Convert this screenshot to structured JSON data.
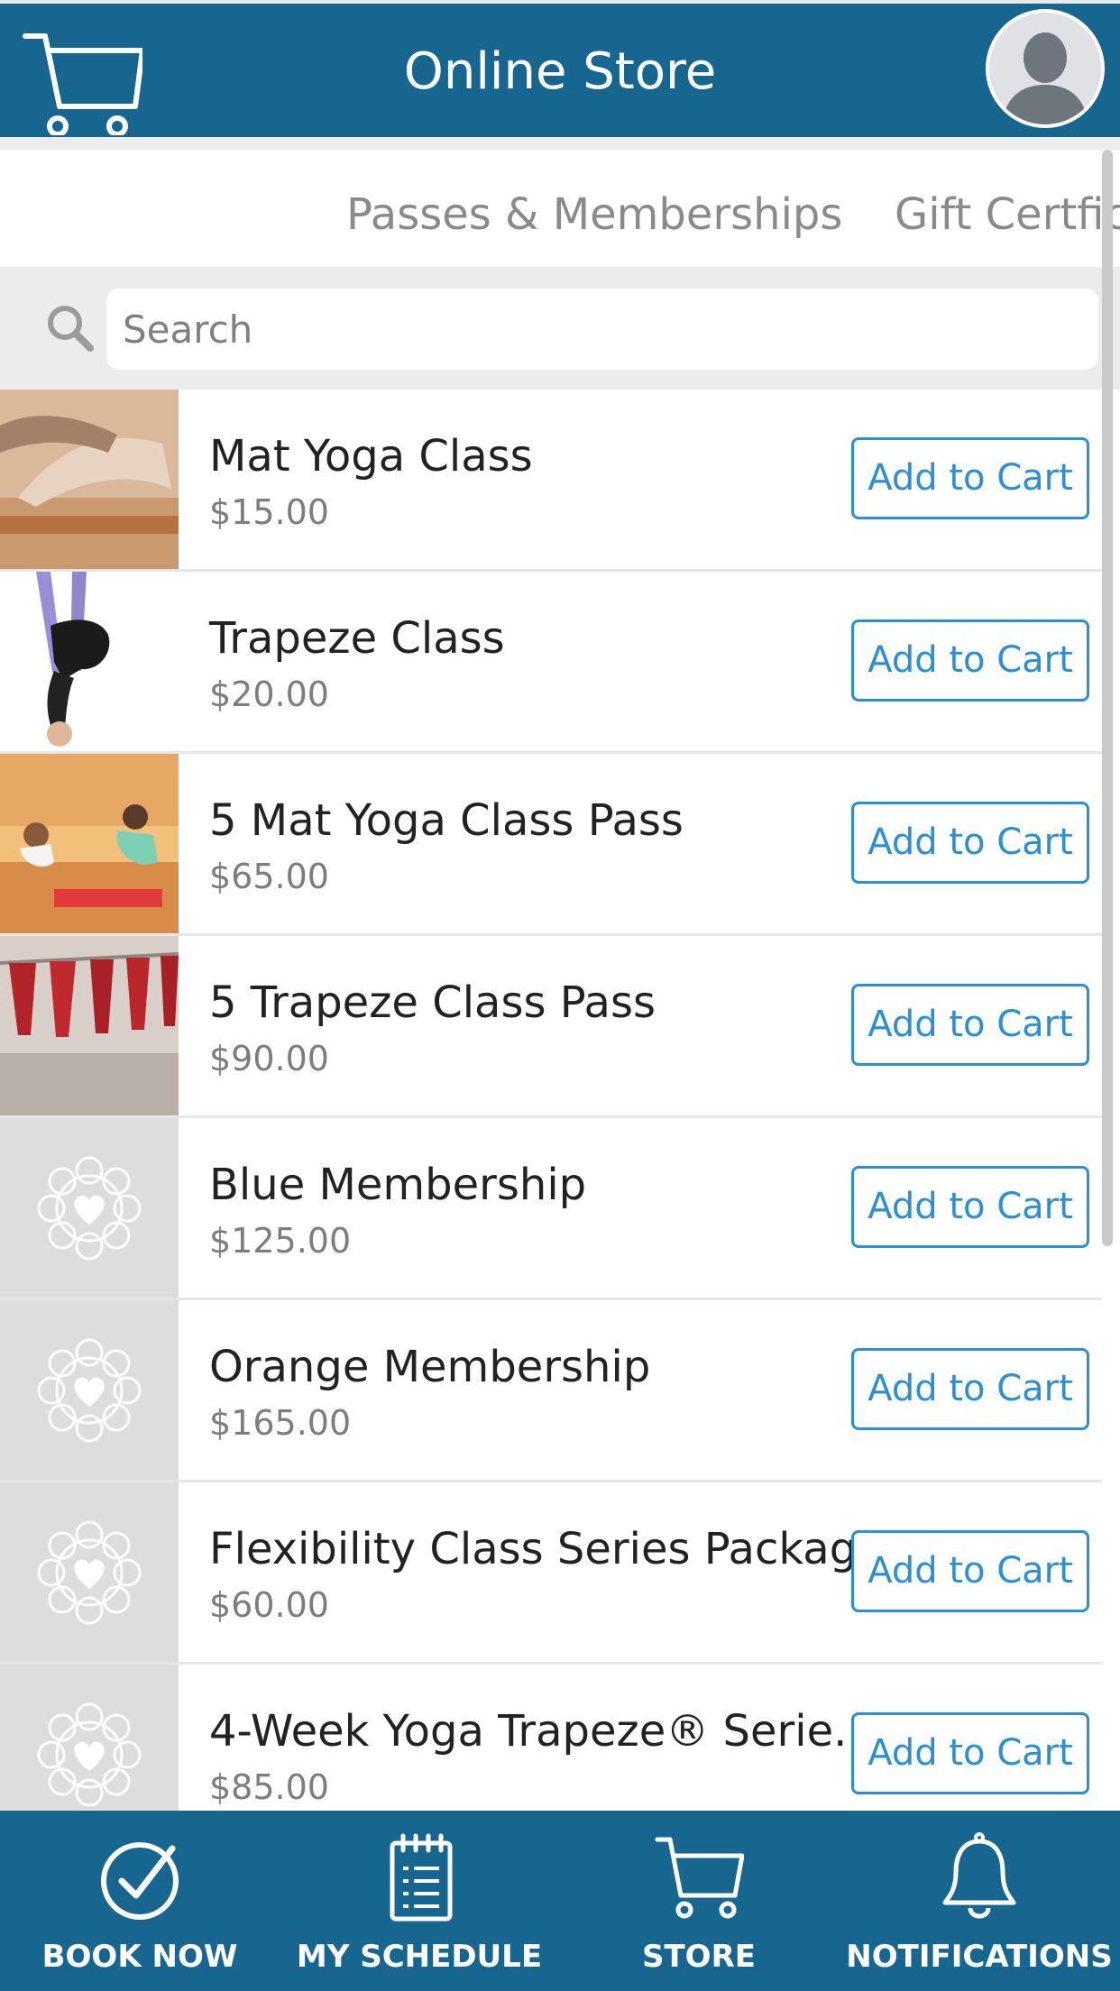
{
  "header": {
    "title": "Online Store",
    "cart_icon": "shopping-cart-icon",
    "avatar_icon": "user-avatar-icon"
  },
  "tabs": [
    {
      "label": "Passes & Memberships"
    },
    {
      "label": "Gift Certfica"
    }
  ],
  "search": {
    "placeholder": "Search",
    "value": "",
    "icon": "search-icon"
  },
  "products": [
    {
      "name": "Mat Yoga Class",
      "price": "$15.00",
      "button": "Add to Cart"
    },
    {
      "name": "Trapeze Class",
      "price": "$20.00",
      "button": "Add to Cart"
    },
    {
      "name": "5 Mat Yoga Class Pass",
      "price": "$65.00",
      "button": "Add to Cart"
    },
    {
      "name": "5 Trapeze Class Pass",
      "price": "$90.00",
      "button": "Add to Cart"
    },
    {
      "name": "Blue Membership",
      "price": "$125.00",
      "button": "Add to Cart"
    },
    {
      "name": "Orange Membership",
      "price": "$165.00",
      "button": "Add to Cart"
    },
    {
      "name": "Flexibility Class Series Package",
      "price": "$60.00",
      "button": "Add to Cart"
    },
    {
      "name": "4-Week Yoga Trapeze® Serie...",
      "price": "$85.00",
      "button": "Add to Cart"
    }
  ],
  "bottom_nav": [
    {
      "label": "BOOK NOW",
      "icon": "check-circle-icon"
    },
    {
      "label": "MY SCHEDULE",
      "icon": "notepad-icon"
    },
    {
      "label": "STORE",
      "icon": "shopping-cart-icon"
    },
    {
      "label": "NOTIFICATIONS",
      "icon": "bell-icon"
    }
  ],
  "colors": {
    "brand": "#17668f",
    "accent": "#2a8fd6",
    "placeholder_thumb": "#dddddd"
  }
}
